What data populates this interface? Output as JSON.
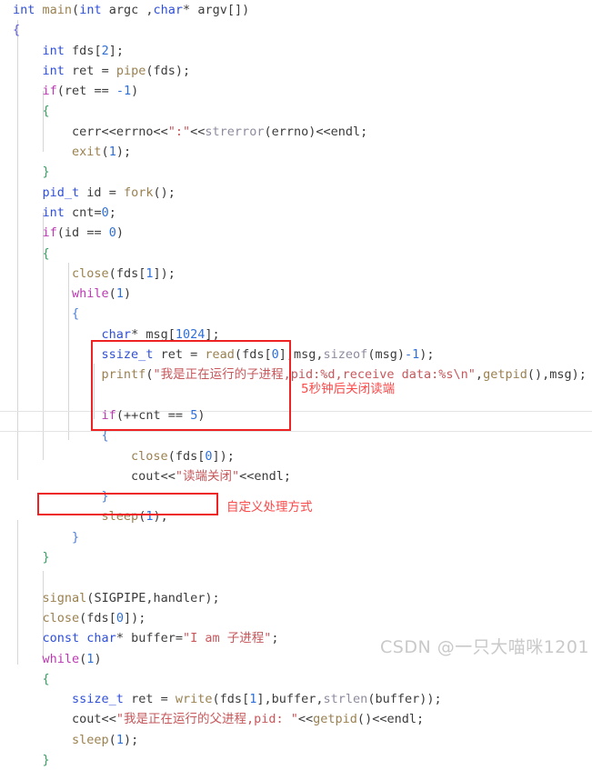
{
  "editor": {
    "language": "cpp",
    "background": "#ffffff",
    "default_text_color": "#3b3b3b",
    "annotation_color": "#fb4a4a",
    "box_color": "#ee2222",
    "watermark_color": "#c9c9c9"
  },
  "code_lines": [
    {
      "indent": 0,
      "text": "int main(int argc ,char* argv[])"
    },
    {
      "indent": 0,
      "text": "{"
    },
    {
      "indent": 1,
      "text": "int fds[2];"
    },
    {
      "indent": 1,
      "text": "int ret = pipe(fds);"
    },
    {
      "indent": 1,
      "text": "if(ret == -1)"
    },
    {
      "indent": 1,
      "text": "{"
    },
    {
      "indent": 2,
      "text": "cerr<<errno<<\":\"<<strerror(errno)<<endl;"
    },
    {
      "indent": 2,
      "text": "exit(1);"
    },
    {
      "indent": 1,
      "text": "}"
    },
    {
      "indent": 1,
      "text": "pid_t id = fork();"
    },
    {
      "indent": 1,
      "text": "int cnt=0;"
    },
    {
      "indent": 1,
      "text": "if(id == 0)"
    },
    {
      "indent": 1,
      "text": "{"
    },
    {
      "indent": 2,
      "text": "close(fds[1]);"
    },
    {
      "indent": 2,
      "text": "while(1)"
    },
    {
      "indent": 2,
      "text": "{"
    },
    {
      "indent": 3,
      "text": "char* msg[1024];"
    },
    {
      "indent": 3,
      "text": "ssize_t ret = read(fds[0],msg,sizeof(msg)-1);"
    },
    {
      "indent": 3,
      "text": "printf(\"我是正在运行的子进程,pid:%d,receive data:%s\\n\",getpid(),msg);"
    },
    {
      "indent": 3,
      "text": ""
    },
    {
      "indent": 3,
      "text": "if(++cnt == 5)"
    },
    {
      "indent": 3,
      "text": "{"
    },
    {
      "indent": 4,
      "text": "close(fds[0]);"
    },
    {
      "indent": 4,
      "text": "cout<<\"读端关闭\"<<endl;"
    },
    {
      "indent": 3,
      "text": "}"
    },
    {
      "indent": 3,
      "text": "sleep(1);"
    },
    {
      "indent": 2,
      "text": "}"
    },
    {
      "indent": 1,
      "text": "}"
    },
    {
      "indent": 1,
      "text": ""
    },
    {
      "indent": 1,
      "text": "signal(SIGPIPE,handler);"
    },
    {
      "indent": 1,
      "text": "close(fds[0]);"
    },
    {
      "indent": 1,
      "text": "const char* buffer=\"I am 子进程\";"
    },
    {
      "indent": 1,
      "text": "while(1)"
    },
    {
      "indent": 1,
      "text": "{"
    },
    {
      "indent": 2,
      "text": "ssize_t ret = write(fds[1],buffer,strlen(buffer));"
    },
    {
      "indent": 2,
      "text": "cout<<\"我是正在运行的父进程,pid: \"<<getpid()<<endl;"
    },
    {
      "indent": 2,
      "text": "sleep(1);"
    },
    {
      "indent": 1,
      "text": "}"
    }
  ],
  "annotations": [
    {
      "id": "close-read-end",
      "label": "5秒钟后关闭读端"
    },
    {
      "id": "custom-handler",
      "label": "自定义处理方式"
    }
  ],
  "watermark": {
    "text": "CSDN @一只大喵咪1201"
  }
}
